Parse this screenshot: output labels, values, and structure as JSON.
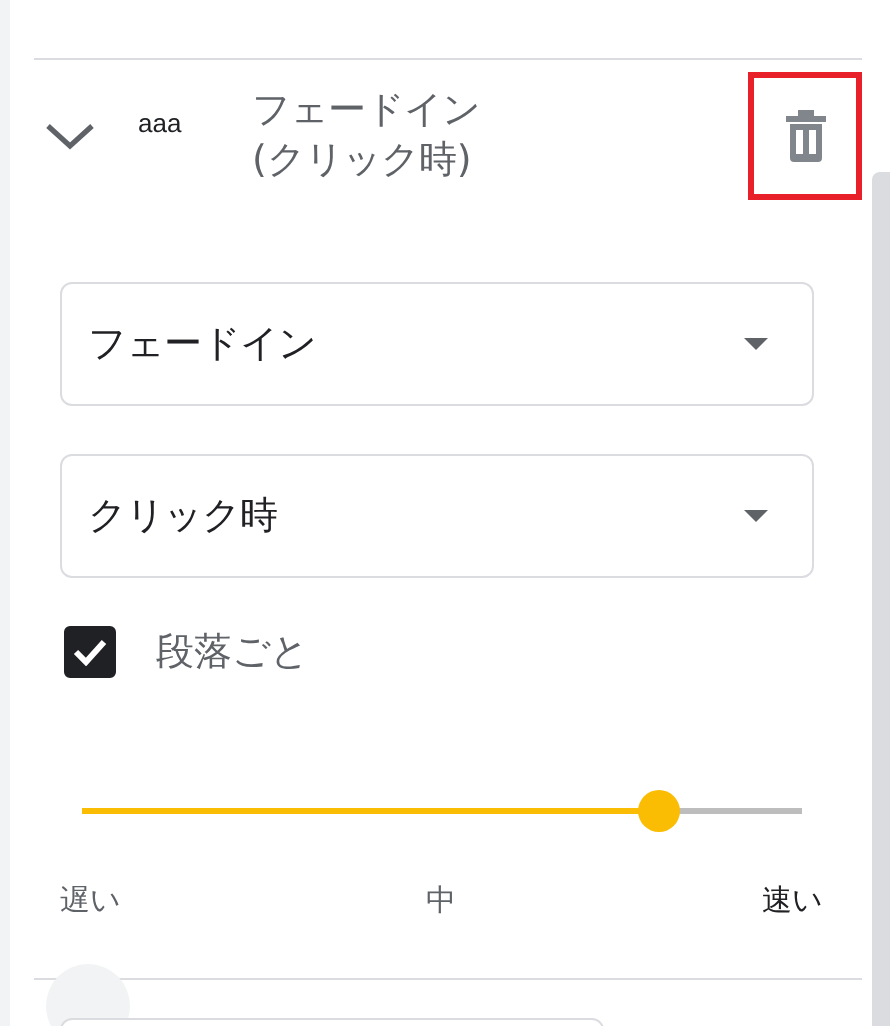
{
  "animation": {
    "expanded": true,
    "tag": "aaa",
    "title": "フェードイン\n(クリック時)"
  },
  "effect_dropdown": {
    "value": "フェードイン"
  },
  "trigger_dropdown": {
    "value": "クリック時"
  },
  "by_paragraph": {
    "label": "段落ごと",
    "checked": true
  },
  "speed": {
    "level": 0.8,
    "labels": [
      "遅い",
      "中",
      "速い"
    ]
  }
}
